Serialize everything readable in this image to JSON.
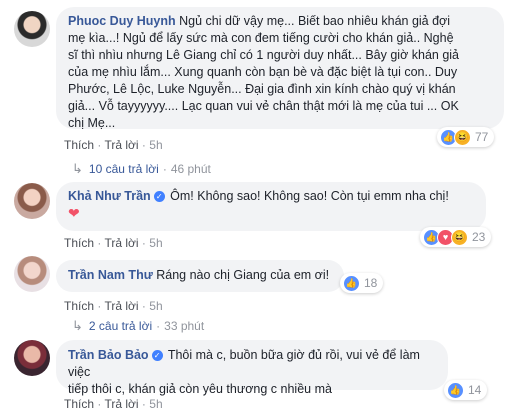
{
  "comments": [
    {
      "name": "Phuoc Duy Huynh",
      "lines": [
        "Ngủ chi dữ vậy mẹ... Biết bao nhiêu khán giả đợi",
        "mẹ kìa...! Ngủ để lấy sức mà con đem tiếng cười cho khán giả.. Nghệ",
        "sĩ thì nhìu nhưng Lê Giang chỉ có 1 người duy nhất... Bây giờ khán giả",
        "của mẹ nhìu lắm... Xung quanh còn bạn bè và đặc biệt là tụi con.. Duy",
        "Phước, Lê Lộc, Luke Nguyễn... Đại gia đình xin kính chào quý vị khán",
        "giả... Vỗ tayyyyyy.... Lạc quan vui vẻ chân thật mới là mẹ của tui ... OK",
        "chị Mẹ..."
      ],
      "reaction_count": "77",
      "like_label": "Thích",
      "reply_label": "Trả lời",
      "time": "5h",
      "replies_summary": "10 câu trả lời",
      "replies_time": "46 phút"
    },
    {
      "name": "Khả Như Trần",
      "lines": [
        "Ôm! Không sao! Không sao! Còn tụi emm nha chị!"
      ],
      "heart": "❤",
      "reaction_count": "23",
      "like_label": "Thích",
      "reply_label": "Trả lời",
      "time": "5h"
    },
    {
      "name": "Trần Nam Thư",
      "lines": [
        "Ráng nào chị Giang của em ơi!"
      ],
      "reaction_count": "18",
      "like_label": "Thích",
      "reply_label": "Trả lời",
      "time": "5h",
      "replies_summary": "2 câu trả lời",
      "replies_time": "33 phút"
    },
    {
      "name": "Trần Bảo Bảo",
      "lines": [
        "Thôi mà c, buồn bữa giờ đủ rồi, vui vẻ để làm việc",
        "tiếp thôi c, khán giả còn yêu thương c nhiều mà"
      ],
      "reaction_count": "14",
      "like_label": "Thích",
      "reply_label": "Trả lời",
      "time": "5h"
    }
  ],
  "separator": "·",
  "colors": {
    "link": "#385898",
    "bubble": "#f2f3f5",
    "meta": "#90949c"
  }
}
